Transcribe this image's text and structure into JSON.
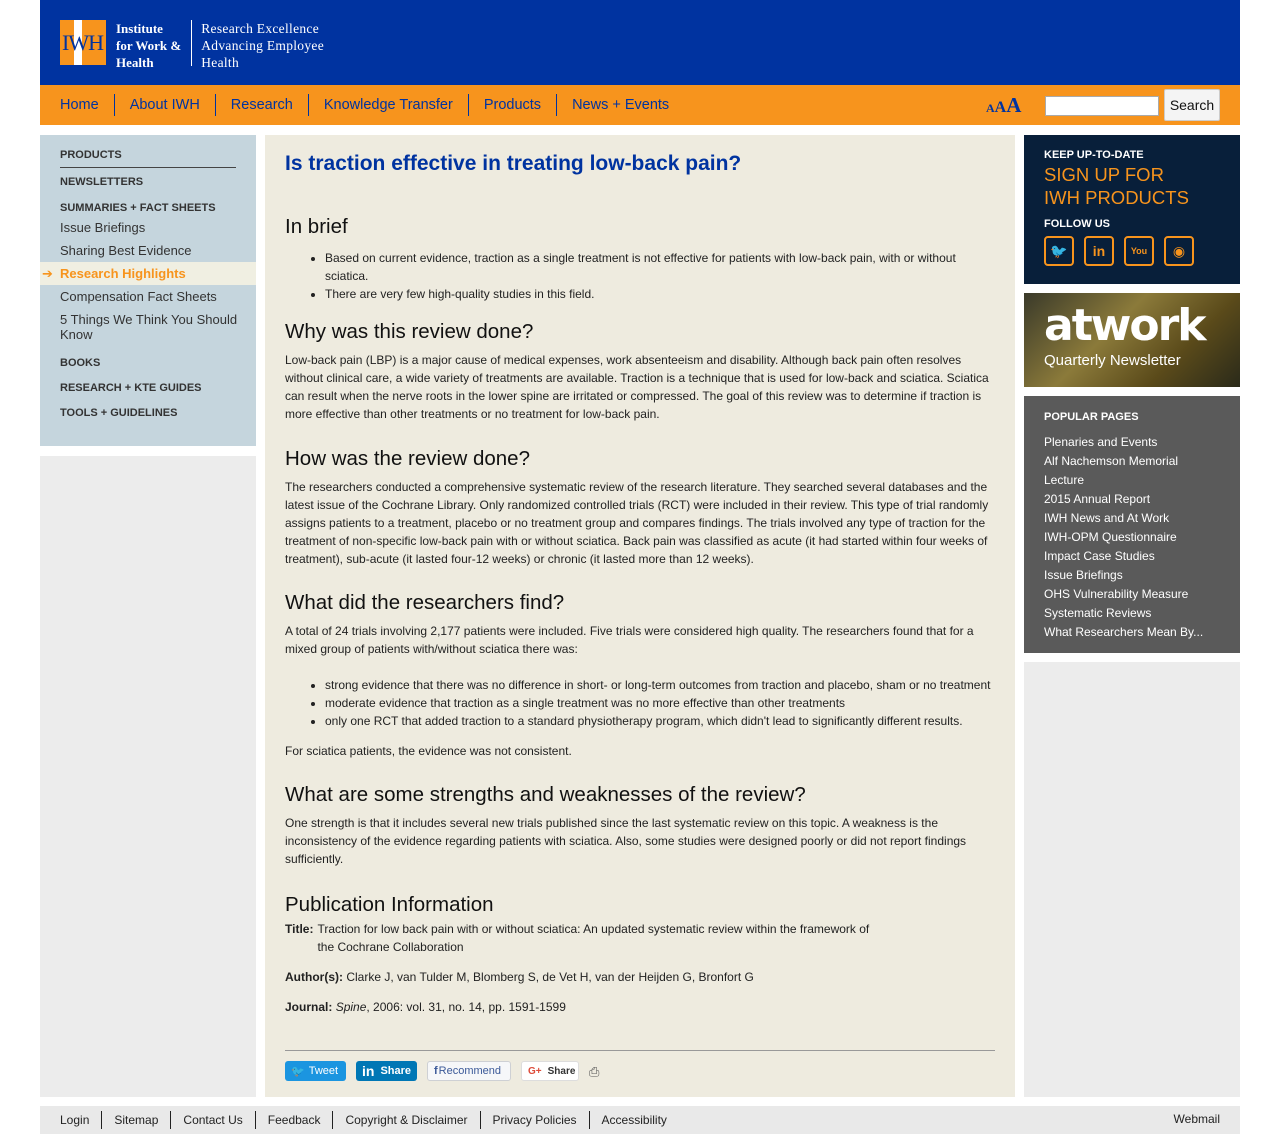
{
  "header": {
    "logo_mark": "IWH",
    "logo_name": [
      "Institute",
      "for Work &",
      "Health"
    ],
    "logo_tagline": [
      "Research Excellence",
      "Advancing Employee",
      "Health"
    ]
  },
  "nav": {
    "items": [
      "Home",
      "About IWH",
      "Research",
      "Knowledge Transfer",
      "Products",
      "News + Events"
    ],
    "font_size_label": [
      "A",
      "A",
      "A"
    ],
    "search_value": "",
    "search_button": "Search"
  },
  "left_nav": {
    "products": "PRODUCTS",
    "newsletters": "NEWSLETTERS",
    "summaries": "SUMMARIES + FACT SHEETS",
    "summary_items": [
      "Issue Briefings",
      "Sharing Best Evidence",
      "Research Highlights",
      "Compensation Fact Sheets",
      "5 Things We Think You Should Know"
    ],
    "books": "BOOKS",
    "guides": "RESEARCH + KTE GUIDES",
    "tools": "TOOLS + GUIDELINES"
  },
  "main": {
    "title": "Is traction effective in treating low-back pain?",
    "brief_head": "In brief",
    "brief_items": [
      "Based on current evidence, traction as a single treatment is not effective for patients with low-back pain, with or without sciatica.",
      "There are very few high-quality studies in this field."
    ],
    "why_head": "Why was this review done?",
    "why_text": "Low-back pain (LBP) is a major cause of medical expenses, work absenteeism and disability. Although back pain often resolves without clinical care, a wide variety of treatments are available. Traction is a technique that is used for low-back and sciatica. Sciatica can result when the nerve roots in the lower spine are irritated or compressed. The goal of this review was to determine if traction is more effective than other treatments or no treatment for low-back pain.",
    "how_head": "How was the review done?",
    "how_text": "The researchers conducted a comprehensive systematic review of the research literature. They searched several databases and the latest issue of the Cochrane Library. Only randomized controlled trials (RCT) were included in their review. This type of trial randomly assigns patients to a treatment, placebo or no treatment group and compares findings. The trials involved any type of traction for the treatment of non-specific low-back pain with or without sciatica. Back pain was classified as acute (it had started within four weeks of treatment), sub-acute (it lasted four-12 weeks) or chronic (it lasted more than 12 weeks).",
    "find_head": "What did the researchers find?",
    "find_text": "A total of 24 trials involving 2,177 patients were included. Five trials were considered high quality. The researchers found that for a mixed group of patients with/without sciatica there was:",
    "find_items": [
      "strong evidence that there was no difference in short- or long-term outcomes from traction and placebo, sham or no treatment",
      "moderate evidence that traction as a single treatment was no more effective than other treatments",
      "only one RCT that added traction to a standard physiotherapy program, which didn't lead to significantly different results."
    ],
    "find_after": "For sciatica patients, the evidence was not consistent.",
    "sw_head": "What are some strengths and weaknesses of the review?",
    "sw_text": "One strength is that it includes several new trials published since the last systematic review on this topic. A weakness is the inconsistency of the evidence regarding patients with sciatica. Also, some studies were designed poorly or did not report findings sufficiently.",
    "pub_head": "Publication Information",
    "pub_title_label": "Title:",
    "pub_title_line1": "Traction for low back pain with or without sciatica: An updated systematic review within the framework of",
    "pub_title_line2": "the Cochrane Collaboration",
    "pub_author_label": "Author(s):",
    "pub_authors": "Clarke J, van Tulder M, Blomberg S, de Vet H, van der Heijden G, Bronfort G",
    "pub_journal_label": "Journal:",
    "pub_journal_name": "Spine",
    "pub_journal_rest": ", 2006: vol. 31, no. 14, pp. 1591-1599"
  },
  "share": {
    "tweet": "Tweet",
    "linkedin": "Share",
    "facebook": "Recommend",
    "google": "Share"
  },
  "right": {
    "keep_up": "KEEP UP-TO-DATE",
    "signup_line1": "SIGN UP FOR",
    "signup_line2": "IWH PRODUCTS",
    "follow": "FOLLOW US",
    "socials": [
      "twitter-icon",
      "linkedin-icon",
      "youtube-icon",
      "rss-icon"
    ],
    "atwork_logo": "atwork",
    "atwork_sub": "Quarterly Newsletter",
    "popular_head": "POPULAR PAGES",
    "popular_items": [
      "Plenaries and Events",
      "Alf Nachemson Memorial Lecture",
      "2015 Annual Report",
      "IWH News and At Work",
      "IWH-OPM Questionnaire",
      "Impact Case Studies",
      "Issue Briefings",
      "OHS Vulnerability Measure",
      "Systematic Reviews",
      "What Researchers Mean By..."
    ]
  },
  "footer": {
    "links": [
      "Login",
      "Sitemap",
      "Contact Us",
      "Feedback",
      "Copyright & Disclaimer",
      "Privacy Policies",
      "Accessibility"
    ],
    "webmail": "Webmail"
  },
  "colors": {
    "brand_blue": "#0033a0",
    "brand_orange": "#f7941d",
    "main_bg": "#eeebdf",
    "left_nav_bg": "#c5d5dd",
    "popular_bg": "#5a5a5a",
    "signup_bg": "#081f3a"
  }
}
